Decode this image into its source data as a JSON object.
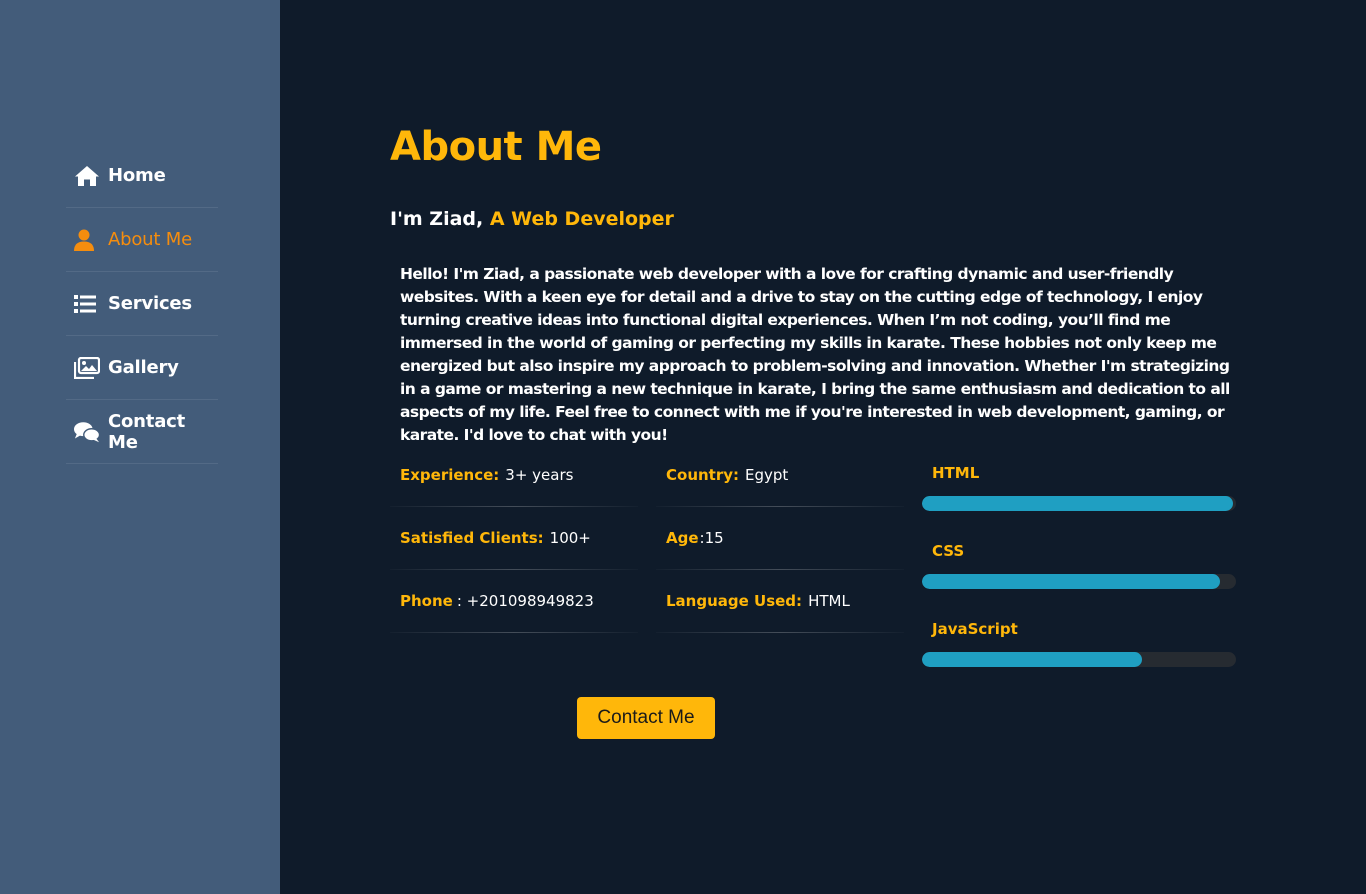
{
  "sidebar": {
    "items": [
      {
        "label": "Home",
        "icon": "home-icon"
      },
      {
        "label": "About Me",
        "icon": "user-icon",
        "active": true
      },
      {
        "label": "Services",
        "icon": "list-icon"
      },
      {
        "label": "Gallery",
        "icon": "images-icon"
      },
      {
        "label": "Contact Me",
        "icon": "comments-icon"
      }
    ]
  },
  "about": {
    "title": "About Me",
    "intro_prefix": "I'm Ziad,",
    "intro_role": "A Web Developer",
    "bio": "Hello! I'm Ziad, a passionate web developer with a love for crafting dynamic and user-friendly websites. With a keen eye for detail and a drive to stay on the cutting edge of technology, I enjoy turning creative ideas into functional digital experiences. When I’m not coding, you’ll find me immersed in the world of gaming or perfecting my skills in karate. These hobbies not only keep me energized but also inspire my approach to problem-solving and innovation. Whether I'm strategizing in a game or mastering a new technique in karate, I bring the same enthusiasm and dedication to all aspects of my life. Feel free to connect with me if you're interested in web development, gaming, or karate. I'd love to chat with you!"
  },
  "info": {
    "experience": {
      "label": "Experience:",
      "value": "3+ years"
    },
    "country": {
      "label": "Country:",
      "value": "Egypt"
    },
    "clients": {
      "label": "Satisfied Clients:",
      "value": "100+"
    },
    "age": {
      "label": "Age",
      "value": ":15"
    },
    "phone": {
      "label": "Phone",
      "value": ": +201098949823"
    },
    "language": {
      "label": "Language Used:",
      "value": "HTML"
    }
  },
  "skills": [
    {
      "name": "HTML",
      "level": 0.99
    },
    {
      "name": "CSS",
      "level": 0.95
    },
    {
      "name": "JavaScript",
      "level": 0.7
    }
  ],
  "contact_button": "Contact Me",
  "colors": {
    "accent": "#ffb70a",
    "active_nav": "#f58d0e",
    "sidebar_bg": "#435c7a",
    "main_bg": "#0f1b2a",
    "skill_bar": "#1f9fc2"
  }
}
